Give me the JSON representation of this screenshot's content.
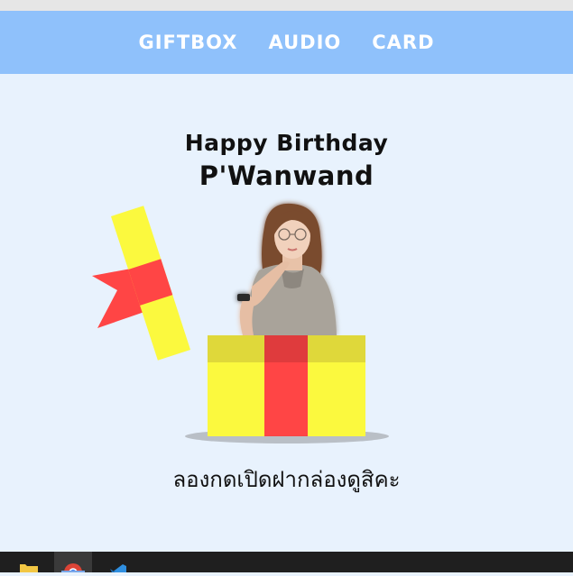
{
  "nav": {
    "items": [
      "GIFTBOX",
      "AUDIO",
      "CARD"
    ]
  },
  "greeting": {
    "line1": "Happy Birthday",
    "line2": "P'Wanwand"
  },
  "hint": "ลองกดเปิดฝากล่องดูสิคะ",
  "icons": [
    "folder-icon",
    "chrome-icon",
    "vscode-icon"
  ],
  "colors": {
    "navbar": "#8fc1fb",
    "background": "#e8f2fd",
    "box_yellow": "#fbf93e",
    "ribbon_red": "#ff4545"
  }
}
